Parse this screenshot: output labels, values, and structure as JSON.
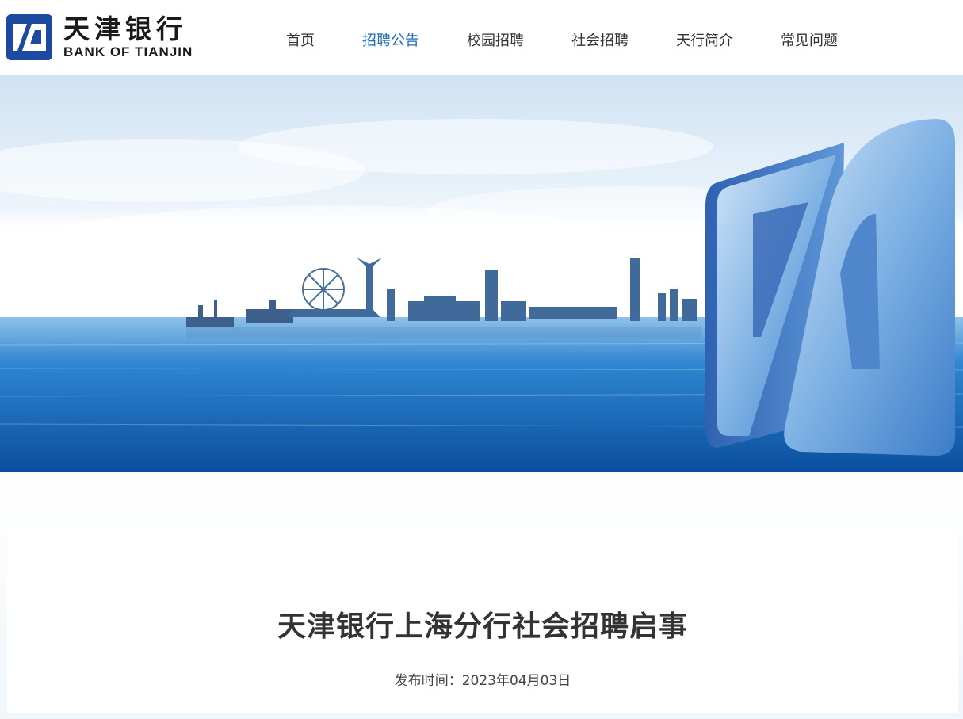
{
  "brand": {
    "name_cn": "天津银行",
    "name_en": "BANK OF TIANJIN",
    "color": "#1b4aa0"
  },
  "nav": {
    "items": [
      {
        "label": "首页",
        "active": false
      },
      {
        "label": "招聘公告",
        "active": true
      },
      {
        "label": "校园招聘",
        "active": false
      },
      {
        "label": "社会招聘",
        "active": false
      },
      {
        "label": "天行简介",
        "active": false
      },
      {
        "label": "常见问题",
        "active": false
      }
    ],
    "active_color": "#1f6cb5"
  },
  "banner": {
    "icon": "bank-logo-3d-icon"
  },
  "article": {
    "title": "天津银行上海分行社会招聘启事",
    "date_label": "发布时间：",
    "date": "2023年04月03日"
  }
}
